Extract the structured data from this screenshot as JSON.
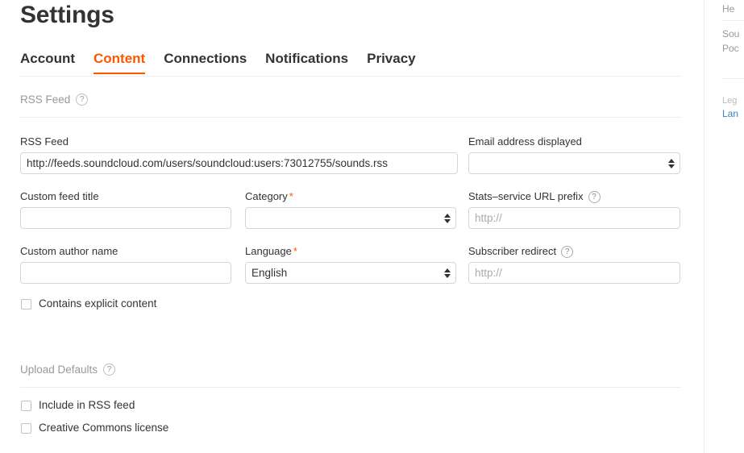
{
  "page": {
    "title": "Settings"
  },
  "tabs": [
    {
      "label": "Account",
      "active": false
    },
    {
      "label": "Content",
      "active": true
    },
    {
      "label": "Connections",
      "active": false
    },
    {
      "label": "Notifications",
      "active": false
    },
    {
      "label": "Privacy",
      "active": false
    }
  ],
  "sections": {
    "rss_feed": {
      "heading": "RSS Feed",
      "help_glyph": "?"
    },
    "upload_defaults": {
      "heading": "Upload Defaults",
      "help_glyph": "?"
    }
  },
  "fields": {
    "rss_feed_url": {
      "label": "RSS Feed",
      "value": "http://feeds.soundcloud.com/users/soundcloud:users:73012755/sounds.rss",
      "placeholder": ""
    },
    "email_displayed": {
      "label": "Email address displayed",
      "value": "",
      "options": [
        ""
      ]
    },
    "custom_feed_title": {
      "label": "Custom feed title",
      "value": "",
      "placeholder": ""
    },
    "category": {
      "label": "Category",
      "required": true,
      "required_marker": "*",
      "value": "",
      "options": [
        ""
      ]
    },
    "stats_service_url_prefix": {
      "label": "Stats–service URL prefix",
      "help_glyph": "?",
      "value": "",
      "placeholder": "http://"
    },
    "custom_author_name": {
      "label": "Custom author name",
      "value": "",
      "placeholder": ""
    },
    "language": {
      "label": "Language",
      "required": true,
      "required_marker": "*",
      "value": "English",
      "options": [
        "English"
      ]
    },
    "subscriber_redirect": {
      "label": "Subscriber redirect",
      "help_glyph": "?",
      "value": "",
      "placeholder": "http://"
    }
  },
  "checkboxes": {
    "explicit": {
      "label": "Contains explicit content",
      "checked": false
    },
    "include_rss": {
      "label": "Include in RSS feed",
      "checked": false
    },
    "creative_commons": {
      "label": "Creative Commons license",
      "checked": false
    }
  },
  "sidebar": {
    "help": "He",
    "sounds": "Sou",
    "podcast": "Poc",
    "legal_heading": "Leg",
    "language_link": "Lan"
  },
  "colors": {
    "accent": "#ff5500",
    "text": "#333333",
    "muted": "#999999",
    "border": "#d5d5d5",
    "rule": "#ececec",
    "link_blue": "#3b7fc4"
  }
}
